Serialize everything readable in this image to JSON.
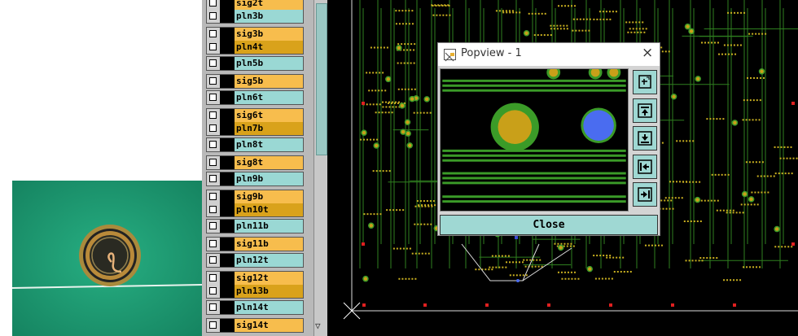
{
  "layers": [
    {
      "label": "sig2t",
      "kind": "sig"
    },
    {
      "label": "pln3b",
      "kind": "plane"
    },
    {
      "label": "sig3b",
      "kind": "sig",
      "active": true
    },
    {
      "label": "pln4t",
      "kind": "dk"
    },
    {
      "label": "pln5b",
      "kind": "plane"
    },
    {
      "label": "sig5b",
      "kind": "sig"
    },
    {
      "label": "pln6t",
      "kind": "plane"
    },
    {
      "label": "sig6t",
      "kind": "sig"
    },
    {
      "label": "pln7b",
      "kind": "dk"
    },
    {
      "label": "pln8t",
      "kind": "plane"
    },
    {
      "label": "sig8t",
      "kind": "sig"
    },
    {
      "label": "pln9b",
      "kind": "plane"
    },
    {
      "label": "sig9b",
      "kind": "sig"
    },
    {
      "label": "pln10t",
      "kind": "dk"
    },
    {
      "label": "pln11b",
      "kind": "plane"
    },
    {
      "label": "sig11b",
      "kind": "sig"
    },
    {
      "label": "pln12t",
      "kind": "plane"
    },
    {
      "label": "sig12t",
      "kind": "sig"
    },
    {
      "label": "pln13b",
      "kind": "dk"
    },
    {
      "label": "pln14t",
      "kind": "plane"
    },
    {
      "label": "sig14t",
      "kind": "sig"
    }
  ],
  "popup": {
    "title": "Popview - 1",
    "close_label": "Close",
    "close_icon": "×"
  },
  "colors": {
    "plane": "#9ad8d4",
    "signal": "#f7bd4d",
    "trace": "#3b9b28",
    "pad": "#c9a019",
    "via": "#4a6cf0"
  }
}
